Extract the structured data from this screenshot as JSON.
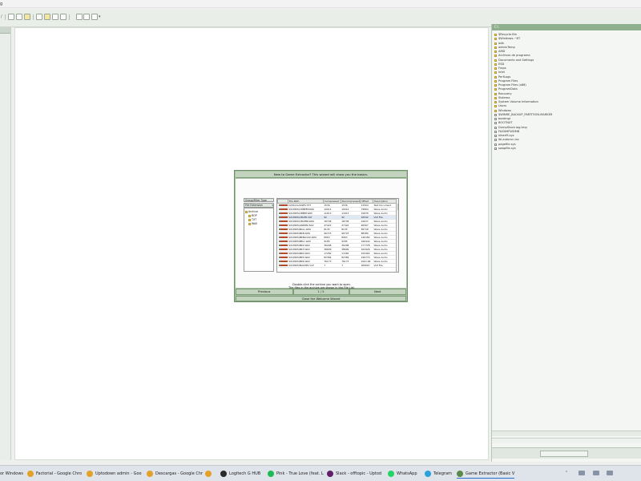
{
  "window": {
    "title": "g"
  },
  "toolbar": {
    "icons": [
      "open-icon",
      "save-icon",
      "folder-icon",
      "archive-icon",
      "doc-icon",
      "doc-icon",
      "image-icon",
      "image-icon",
      "tools-icon",
      "plugin-icon",
      "dropdown-icon"
    ]
  },
  "right_panel": {
    "header": "C:\\",
    "items": [
      "$Recycle.Bin",
      "$Windows.~BT",
      "adb",
      "adminTemp",
      "AMD",
      "Archivos de programa",
      "Documents and Settings",
      "ESD",
      "Fraps",
      "Intel",
      "PerfLogs",
      "Program Files",
      "Program Files (x86)",
      "ProgramData",
      "Recovery",
      "Sistema",
      "System Volume Information",
      "Users",
      "Windows",
      "$WINRE_BACKUP_PARTITION.MARKER",
      "bootmgr",
      "BOOTNXT",
      "DumpStack.log.tmp",
      "FAZAMFWDMB",
      "hiberfil.sys",
      "lbl.autorun.inc",
      "pagefile.sys",
      "swapfile.sys"
    ]
  },
  "dialog": {
    "heading": "New to Game Extractor? This wizard will show you the basics.",
    "filetype_label": "Group/Filter Type",
    "filetype_value": "File Extension",
    "tree": [
      {
        "label": "Archive",
        "child": false
      },
      {
        "label": "BOP",
        "child": true
      },
      {
        "label": "TXT",
        "child": true
      },
      {
        "label": "WAV",
        "child": true
      }
    ],
    "columns": [
      "",
      "File Path",
      "Compressed",
      "Decompressed",
      "Offset",
      "Description"
    ],
    "rows": [
      [
        "DATA\\CLASSES.TXT",
        "1536",
        "1536",
        "21504",
        "Text Document"
      ],
      [
        "SOUNDS\\CDBEEP.WAV",
        "10014",
        "10014",
        "79864",
        "Wave Audio"
      ],
      [
        "SOUNDS\\CBEEP.WAV",
        "11613",
        "11613",
        "15878",
        "Wave Audio"
      ],
      [
        "SOUNDS\\CELEB.VLP",
        "92",
        "92",
        "16542",
        "VLP File"
      ],
      [
        "SOUNDS\\CELEBR.WAV",
        "18738",
        "18738",
        "24637",
        "Wave Audio"
      ],
      [
        "SOUNDS\\ANDRN.WAV",
        "47422",
        "47422",
        "46567",
        "Wave Audio"
      ],
      [
        "SOUNDS\\BALL.WAV",
        "8135",
        "8135",
        "89718",
        "Wave Audio"
      ],
      [
        "SOUNDS\\BRN.WAV",
        "96723",
        "96723",
        "88380",
        "Wave Audio"
      ],
      [
        "SOUNDS\\BRNLOAD.WAV",
        "8963",
        "8963",
        "146182",
        "Wave Audio"
      ],
      [
        "SOUNDS\\BELL.WAV",
        "9185",
        "9185",
        "166444",
        "Wave Audio"
      ],
      [
        "SOUNDS\\BR2.WAV",
        "36298",
        "36298",
        "177728",
        "Wave Audio"
      ],
      [
        "SOUNDS\\BR3.WAV",
        "38699",
        "38699",
        "162926",
        "Wave Audio"
      ],
      [
        "SOUNDS\\BR4.WAV",
        "17282",
        "17282",
        "225462",
        "Wave Audio"
      ],
      [
        "SOUNDS\\BR5.WAV",
        "82384",
        "82384",
        "246774",
        "Wave Audio"
      ],
      [
        "SOUNDS\\BR6.WAV",
        "76173",
        "76173",
        "9161.84",
        "Wave Audio"
      ],
      [
        "SOUNDS\\BLUMP2.VLP",
        "7",
        "7",
        "369007",
        "VLP File"
      ]
    ],
    "note_line1": "Double-click the archive you want to open.",
    "note_line2": "The files in the archive are shown in the File List.",
    "previous_label": "Previous",
    "page_label": "1 / 5",
    "next_label": "Next",
    "close_label": "Close the Welcome Wizard"
  },
  "taskbar": {
    "items": [
      {
        "label": "or Windows",
        "color": "#4a6fb5"
      },
      {
        "label": "Factorial - Google Chro",
        "color": "#e4a12a"
      },
      {
        "label": "Uptodown admin - Goo",
        "color": "#e4a12a"
      },
      {
        "label": "Descargas - Google Chr",
        "color": "#e4a12a"
      },
      {
        "label": "",
        "color": "#e4a12a"
      },
      {
        "label": "Logitech G HUB",
        "color": "#2a2a2a"
      },
      {
        "label": "Pink - True Love (feat. L",
        "color": "#1db954"
      },
      {
        "label": "Slack - offtopic - Uptod",
        "color": "#611f69"
      },
      {
        "label": "WhatsApp",
        "color": "#25d366"
      },
      {
        "label": "Telegram",
        "color": "#2aa1da"
      },
      {
        "label": "Game Extractor (Basic V",
        "color": "#5a8a4a"
      }
    ],
    "tray": [
      "^",
      "wifi",
      "speaker",
      "lang"
    ]
  }
}
